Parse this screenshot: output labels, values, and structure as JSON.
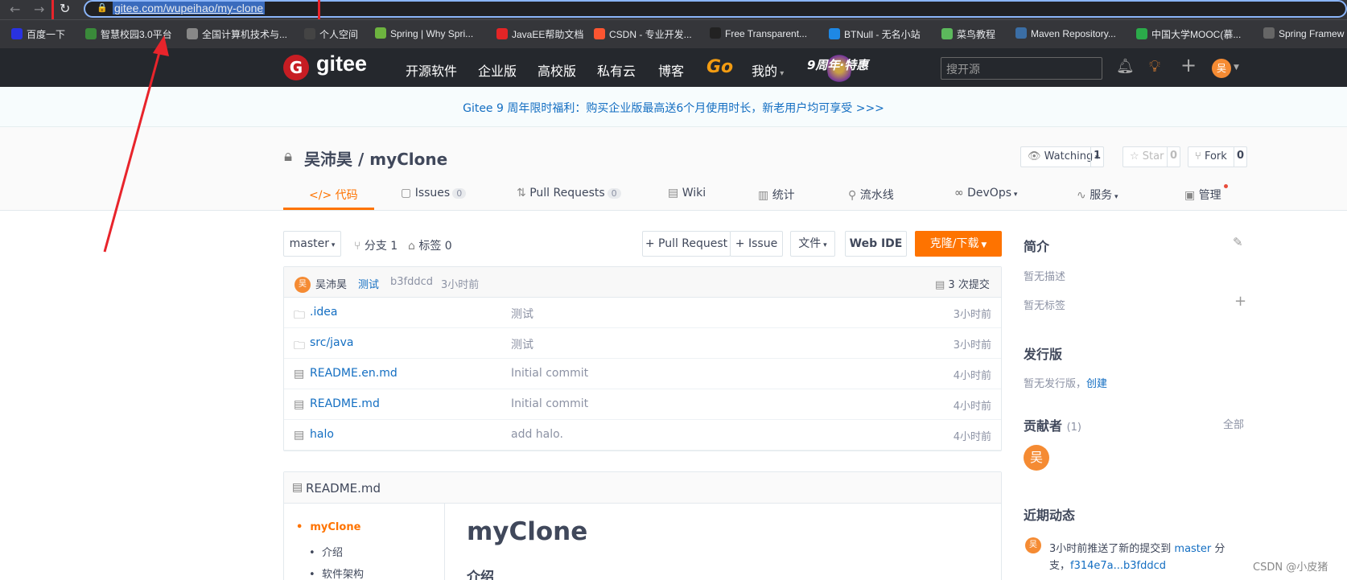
{
  "browser": {
    "url": "gitee.com/wupeihao/my-clone",
    "bookmarks": [
      {
        "label": "百度一下",
        "color": "#2932e1"
      },
      {
        "label": "智慧校园3.0平台",
        "color": "#3a8a3a"
      },
      {
        "label": "全国计算机技术与...",
        "color": "#888888"
      },
      {
        "label": "个人空间",
        "color": "#444444"
      },
      {
        "label": "Spring | Why Spri...",
        "color": "#6db33f"
      },
      {
        "label": "JavaEE帮助文档",
        "color": "#e32526"
      },
      {
        "label": "CSDN - 专业开发...",
        "color": "#fc5531"
      },
      {
        "label": "Free Transparent...",
        "color": "#222222"
      },
      {
        "label": "BTNull - 无名小站",
        "color": "#1e88e5"
      },
      {
        "label": "菜鸟教程",
        "color": "#5cb85c"
      },
      {
        "label": "Maven Repository...",
        "color": "#3b6ea5"
      },
      {
        "label": "中国大学MOOC(慕...",
        "color": "#2bab4a"
      },
      {
        "label": "Spring Framew",
        "color": "#666666"
      }
    ]
  },
  "gitee": {
    "logo": "gitee",
    "logo_badge": "G",
    "nav": [
      "开源软件",
      "企业版",
      "高校版",
      "私有云",
      "博客"
    ],
    "nav_go": "Go",
    "nav_mine": "我的",
    "anniversary": "9周年·特惠",
    "search_placeholder": "搜开源",
    "avatar_char": "吴"
  },
  "banner": "Gitee 9 周年限时福利：购买企业版最高送6个月使用时长，新老用户均可享受 >>>",
  "project": {
    "title": "吴沛昊 / myClone",
    "watching_label": "Watching",
    "watching_count": "1",
    "star_label": "Star",
    "star_count": "0",
    "fork_label": "Fork",
    "fork_count": "0",
    "tabs": [
      {
        "label": "代码",
        "icon": "code-icon"
      },
      {
        "label": "Issues",
        "badge": "0",
        "icon": "issues-icon"
      },
      {
        "label": "Pull Requests",
        "badge": "0",
        "icon": "pull-request-icon"
      },
      {
        "label": "Wiki",
        "icon": "wiki-icon"
      },
      {
        "label": "统计",
        "icon": "stats-icon"
      },
      {
        "label": "流水线",
        "icon": "pipeline-icon"
      },
      {
        "label": "DevOps",
        "icon": "devops-icon"
      },
      {
        "label": "服务",
        "icon": "service-icon"
      },
      {
        "label": "管理",
        "icon": "manage-icon"
      }
    ]
  },
  "toolbar": {
    "branch": "master",
    "branches": "分支 1",
    "tags": "标签 0",
    "pull_request": "+ Pull Request",
    "issue": "+ Issue",
    "files": "文件",
    "webide": "Web IDE",
    "clone": "克隆/下载"
  },
  "commit": {
    "avatar": "吴",
    "author": "吴沛昊",
    "message": "测试",
    "hash": "b3fddcd",
    "time": "3小时前",
    "count": "3 次提交"
  },
  "files": [
    {
      "name": ".idea",
      "type": "folder",
      "message": "测试",
      "time": "3小时前"
    },
    {
      "name": "src/java",
      "type": "folder",
      "message": "测试",
      "time": "3小时前"
    },
    {
      "name": "README.en.md",
      "type": "file",
      "message": "Initial commit",
      "time": "4小时前"
    },
    {
      "name": "README.md",
      "type": "file",
      "message": "Initial commit",
      "time": "4小时前"
    },
    {
      "name": "halo",
      "type": "file",
      "message": "add halo.",
      "time": "4小时前"
    }
  ],
  "readme": {
    "filename": "README.md",
    "toc": [
      "myClone",
      "介绍",
      "软件架构"
    ],
    "h1": "myClone",
    "h2": "介绍"
  },
  "sidebar": {
    "intro_title": "简介",
    "no_desc": "暂无描述",
    "no_tags": "暂无标签",
    "release_title": "发行版",
    "no_release": "暂无发行版，",
    "create": "创建",
    "contrib_title": "贡献者",
    "contrib_count": "(1)",
    "contrib_all": "全部",
    "contrib_avatar": "吴",
    "activity_title": "近期动态",
    "activity_avatar": "吴",
    "activity_line1_pre": "3小时前推送了新的提交到 ",
    "activity_branch": "master",
    "activity_line1_post": " 分",
    "activity_line2_pre": "支，",
    "activity_commits": "f314e7a...b3fddcd"
  },
  "watermark": "CSDN @小皮猪"
}
